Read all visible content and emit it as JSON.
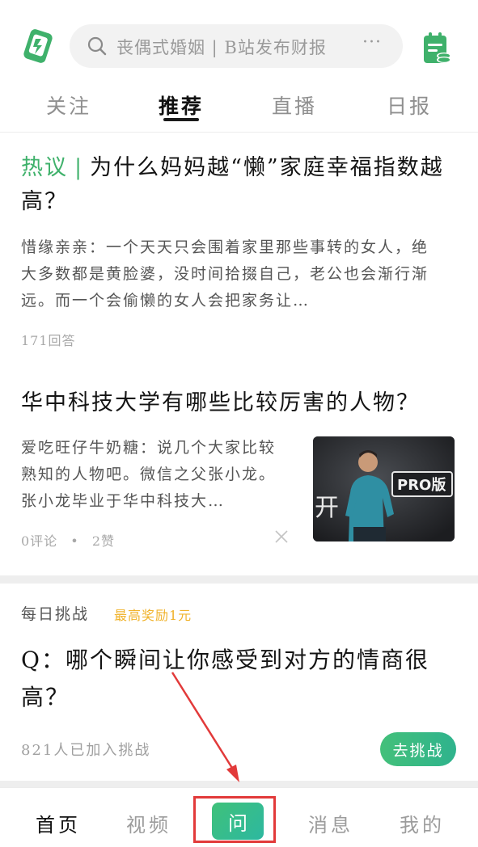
{
  "header": {
    "search_placeholder": "丧偶式婚姻 | B站发布财报",
    "search_more": "···"
  },
  "tabs": [
    {
      "label": "关注",
      "active": false
    },
    {
      "label": "推荐",
      "active": true
    },
    {
      "label": "直播",
      "active": false
    },
    {
      "label": "日报",
      "active": false
    }
  ],
  "feed": [
    {
      "tag": "热议",
      "title": "为什么妈妈越“懒”家庭幸福指数越高？",
      "excerpt": "惜缘亲亲：一个天天只会围着家里那些事转的女人，绝大多数都是黄脸婆，没时间拾掇自己，老公也会渐行渐远。而一个会偷懒的女人会把家务让…",
      "meta": "171回答"
    },
    {
      "title": "华中科技大学有哪些比较厉害的人物？",
      "excerpt": "爱吃旺仔牛奶糖：说几个大家比较熟知的人物吧。微信之父张小龙。张小龙毕业于华中科技大…",
      "comments": "0评论",
      "dot": "•",
      "likes": "2赞",
      "thumb_text": "PRO版",
      "thumb_char": "开"
    }
  ],
  "challenge": {
    "head": "每日挑战",
    "reward": "最高奖励1元",
    "question": "Q：哪个瞬间让你感受到对方的情商很高？",
    "count": "821人已加入挑战",
    "button": "去挑战"
  },
  "bottom_nav": {
    "home": "首页",
    "video": "视频",
    "ask": "问",
    "messages": "消息",
    "mine": "我的"
  },
  "colors": {
    "accent": "#3fb16b",
    "reward": "#f0b22a",
    "highlight": "#e23a3a"
  }
}
